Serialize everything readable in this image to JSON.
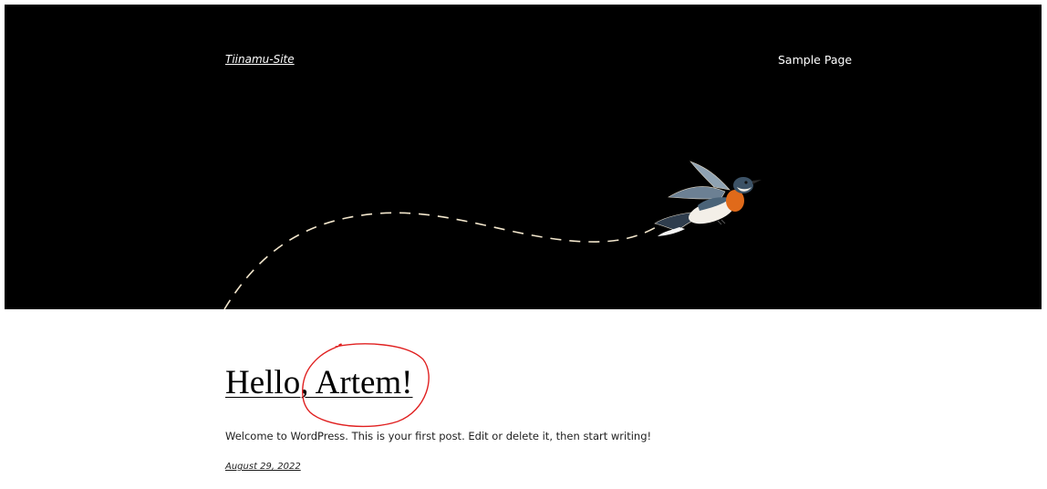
{
  "header": {
    "site_title": "Tiinamu-Site",
    "nav": [
      {
        "label": "Sample Page"
      }
    ],
    "background_color": "#000000",
    "illustration_icon": "bird-icon"
  },
  "post": {
    "title": "Hello, Artem!",
    "excerpt": "Welcome to WordPress. This is your first post. Edit or delete it, then start writing!",
    "date": "August 29, 2022"
  },
  "annotation": {
    "shape": "circle",
    "color": "#e02020"
  }
}
